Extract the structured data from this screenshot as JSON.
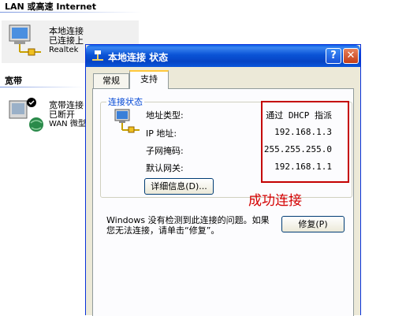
{
  "background": {
    "lan_group_header": "LAN 或高速 Internet",
    "broadband_group_header": "宽带",
    "lan_connection": {
      "name": "本地连接",
      "status": "已连接上",
      "device": "Realtek"
    },
    "broadband_connection": {
      "name": "宽带连接",
      "status": "已断开",
      "device": "WAN 微型"
    }
  },
  "dialog": {
    "title": "本地连接  状态",
    "help_label": "?",
    "close_label": "✕",
    "tabs": [
      {
        "label": "常规"
      },
      {
        "label": "支持"
      }
    ],
    "connection_status": {
      "group_label": "连接状态",
      "rows": [
        {
          "label": "地址类型:",
          "value": "通过 DHCP 指派"
        },
        {
          "label": "IP 地址:",
          "value": "192.168.1.3"
        },
        {
          "label": "子网掩码:",
          "value": "255.255.255.0"
        },
        {
          "label": "默认网关:",
          "value": "192.168.1.1"
        }
      ],
      "details_button": "详细信息(D)..."
    },
    "annotation": "成功连接",
    "help_text_line1": "Windows 没有检测到此连接的问题。如果",
    "help_text_line2": "您无法连接，请单击“修复”。",
    "repair_button": "修复(P)",
    "colors": {
      "titlebar": "#0a53d6",
      "highlight": "#c40000",
      "annotation": "#d40000"
    }
  }
}
